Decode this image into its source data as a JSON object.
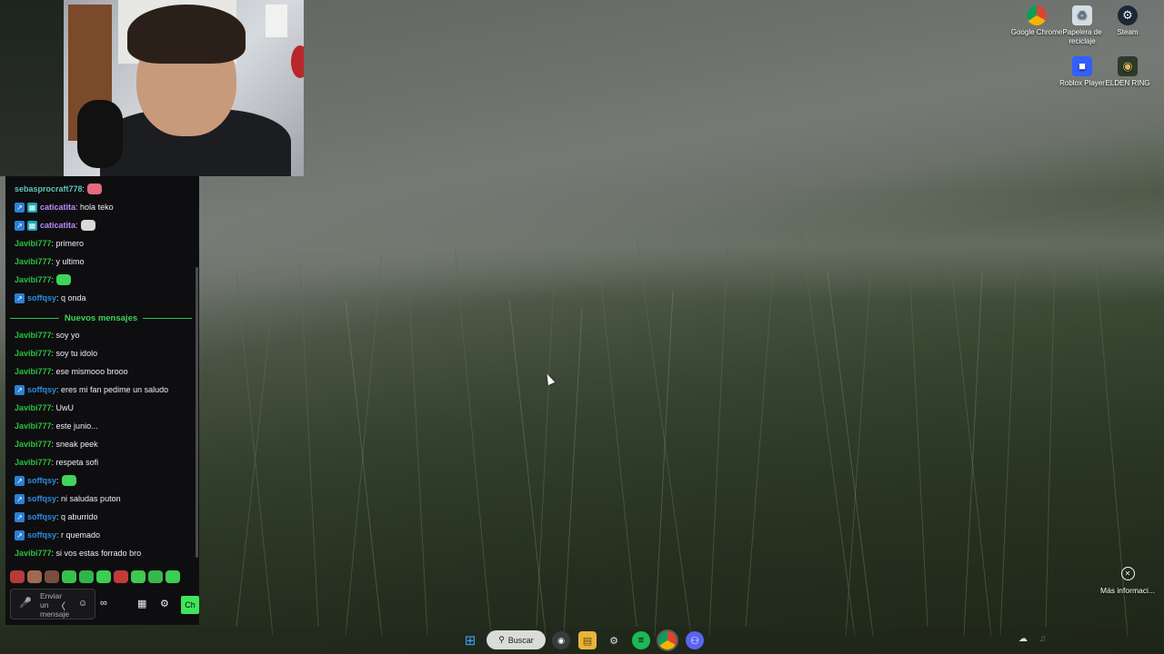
{
  "chat": {
    "messages": [
      {
        "user": "sebasprocraft778",
        "sep": ":",
        "text": "",
        "emote": "blob-emote",
        "badges": [],
        "color": "teal"
      },
      {
        "user": "caticatita",
        "sep": ":",
        "text": " hola teko",
        "badges": [
          "prime",
          "sub"
        ],
        "color": "purple"
      },
      {
        "user": "caticatita",
        "sep": ":",
        "text": "",
        "emote": "duck-emote",
        "badges": [
          "prime",
          "sub"
        ],
        "color": "purple"
      },
      {
        "user": "Javibi777",
        "sep": ":",
        "text": " primero",
        "badges": [],
        "color": "green"
      },
      {
        "user": "Javibi777",
        "sep": ":",
        "text": " y ultimo",
        "badges": [],
        "color": "green"
      },
      {
        "user": "Javibi777",
        "sep": ":",
        "text": "",
        "emote": "frog-emote",
        "badges": [],
        "color": "green"
      },
      {
        "user": "soffqsy",
        "sep": ":",
        "text": " q onda",
        "badges": [
          "prime"
        ],
        "color": "blue"
      }
    ],
    "new_messages_label": "Nuevos mensajes",
    "messages_after": [
      {
        "user": "Javibi777",
        "sep": ":",
        "text": " soy yo",
        "badges": [],
        "color": "green"
      },
      {
        "user": "Javibi777",
        "sep": ":",
        "text": " soy tu idolo",
        "badges": [],
        "color": "green"
      },
      {
        "user": "Javibi777",
        "sep": ":",
        "text": " ese mismooo brooo",
        "badges": [],
        "color": "green"
      },
      {
        "user": "soffqsy",
        "sep": ":",
        "text": " eres mi fan pedime un saludo",
        "badges": [
          "prime"
        ],
        "color": "blue"
      },
      {
        "user": "Javibi777",
        "sep": ":",
        "text": " UwU",
        "badges": [],
        "color": "green"
      },
      {
        "user": "Javibi777",
        "sep": ":",
        "text": " este junio...",
        "badges": [],
        "color": "green"
      },
      {
        "user": "Javibi777",
        "sep": ":",
        "text": " sneak peek",
        "badges": [],
        "color": "green"
      },
      {
        "user": "Javibi777",
        "sep": ":",
        "text": " respeta sofi",
        "badges": [],
        "color": "green"
      },
      {
        "user": "soffqsy",
        "sep": ":",
        "text": "",
        "emote": "frog-emote",
        "badges": [
          "prime"
        ],
        "color": "blue"
      },
      {
        "user": "soffqsy",
        "sep": ":",
        "text": " ni saludas puton",
        "badges": [
          "prime"
        ],
        "color": "blue"
      },
      {
        "user": "soffqsy",
        "sep": ":",
        "text": " q aburrido",
        "badges": [
          "prime"
        ],
        "color": "blue"
      },
      {
        "user": "soffqsy",
        "sep": ":",
        "text": " r quemado",
        "badges": [
          "prime"
        ],
        "color": "blue"
      },
      {
        "user": "Javibi777",
        "sep": ":",
        "text": " si vos estas forrado bro",
        "badges": [],
        "color": "green"
      }
    ],
    "input_placeholder": "Enviar un mensaje",
    "send_label": "Ch"
  },
  "desktop_icons": [
    {
      "label": "Google Chrome",
      "icon": "chrome-icon"
    },
    {
      "label": "Papelera de reciclaje",
      "icon": "recycle-bin-icon"
    },
    {
      "label": "Steam",
      "icon": "steam-icon"
    },
    {
      "label": "Roblox Player",
      "icon": "roblox-icon"
    },
    {
      "label": "ELDEN RING",
      "icon": "elden-ring-icon"
    }
  ],
  "more_info": {
    "label": "Más informaci..."
  },
  "taskbar": {
    "search_label": "Buscar",
    "apps": [
      "start-icon",
      "obs-icon",
      "file-explorer-icon",
      "steam-icon",
      "spotify-icon",
      "chrome-icon",
      "discord-icon"
    ]
  },
  "colors": {
    "chat_bg": "#0e0e10",
    "new_messages_green": "#3fd45a",
    "user_green": "#27c23e",
    "user_blue": "#2b8ce3",
    "user_purple": "#b98cff",
    "user_teal": "#5fc4b9"
  }
}
